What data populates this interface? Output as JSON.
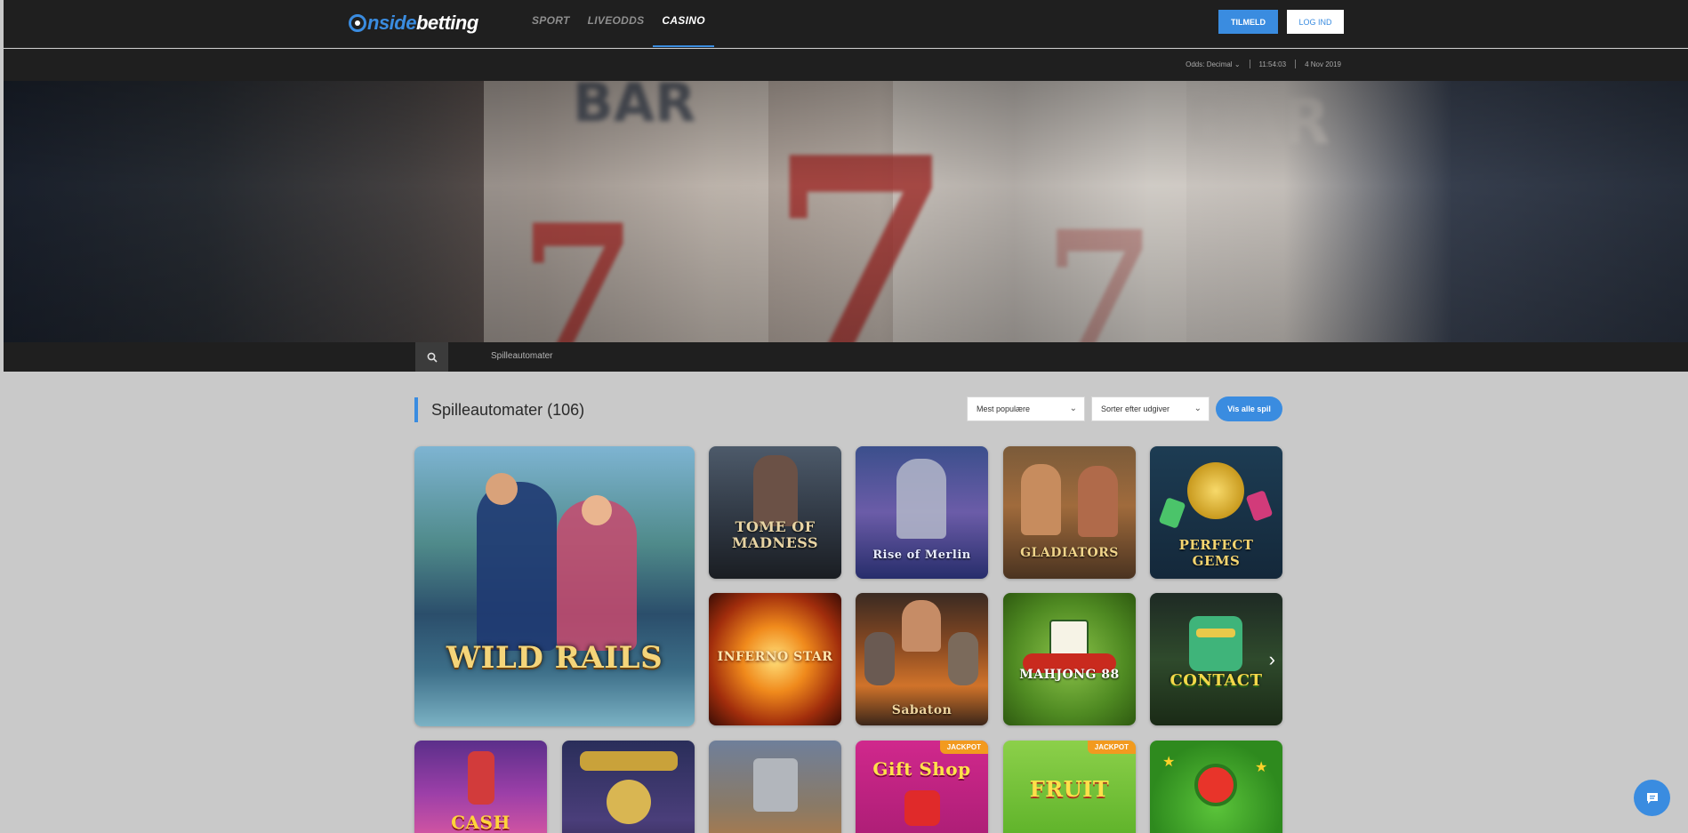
{
  "header": {
    "logo": {
      "part1": "nside",
      "part2": "betting"
    },
    "nav": [
      "SPORT",
      "LIVEODDS",
      "CASINO"
    ],
    "active_nav": "CASINO",
    "signup_label": "TILMELD",
    "login_label": "LOG IND"
  },
  "subbar": {
    "odds_label": "Odds:",
    "odds_format": "Decimal",
    "time": "11:54:03",
    "date": "4 Nov 2019"
  },
  "search": {
    "crumb": "Spilleautomater"
  },
  "section": {
    "title": "Spilleautomater (106)",
    "filter_popular": "Mest populære",
    "filter_provider": "Sorter efter udgiver",
    "view_all": "Vis alle spil"
  },
  "games": [
    {
      "title": "WILD RAILS"
    },
    {
      "title": "TOME OF MADNESS"
    },
    {
      "title": "Rise of Merlin"
    },
    {
      "title": "GLADIATORS"
    },
    {
      "title": "PERFECT GEMS"
    },
    {
      "title": "INFERNO STAR"
    },
    {
      "title": "Sabaton"
    },
    {
      "title": "MAHJONG 88"
    },
    {
      "title": "CONTACT"
    },
    {
      "title": "CASH"
    },
    {
      "title": ""
    },
    {
      "title": ""
    },
    {
      "title": "Gift Shop",
      "badge": "JACKPOT"
    },
    {
      "title": "FRUIT",
      "badge": "JACKPOT"
    },
    {
      "title": ""
    }
  ],
  "colors": {
    "accent": "#3a8ce0",
    "topbar": "#1f1f1f",
    "page_bg": "#c9c9c9",
    "jackpot": "#f29a1f"
  }
}
